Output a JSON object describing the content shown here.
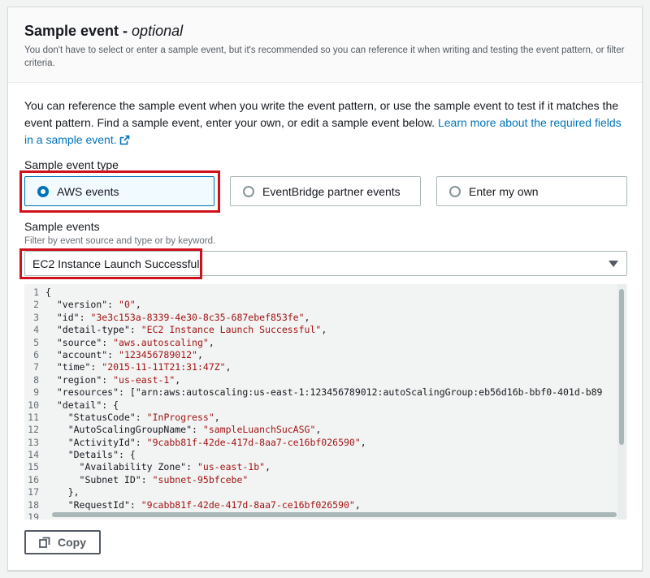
{
  "header": {
    "title": "Sample event - ",
    "title_optional": "optional",
    "description": "You don't have to select or enter a sample event, but it's recommended so you can reference it when writing and testing the event pattern, or filter criteria."
  },
  "intro": {
    "text": "You can reference the sample event when you write the event pattern, or use the sample event to test if it matches the event pattern. Find a sample event, enter your own, or edit a sample event below. ",
    "link": "Learn more about the required fields in a sample event."
  },
  "event_type": {
    "label": "Sample event type",
    "options": [
      {
        "label": "AWS events",
        "selected": true
      },
      {
        "label": "EventBridge partner events",
        "selected": false
      },
      {
        "label": "Enter my own",
        "selected": false
      }
    ]
  },
  "sample_events": {
    "label": "Sample events",
    "hint": "Filter by event source and type or by keyword.",
    "selected": "EC2 Instance Launch Successful"
  },
  "code_lines": [
    {
      "n": "1",
      "text": "{"
    },
    {
      "n": "2",
      "text": "  \"version\": \"0\","
    },
    {
      "n": "3",
      "text": "  \"id\": \"3e3c153a-8339-4e30-8c35-687ebef853fe\","
    },
    {
      "n": "4",
      "text": "  \"detail-type\": \"EC2 Instance Launch Successful\","
    },
    {
      "n": "5",
      "text": "  \"source\": \"aws.autoscaling\","
    },
    {
      "n": "6",
      "text": "  \"account\": \"123456789012\","
    },
    {
      "n": "7",
      "text": "  \"time\": \"2015-11-11T21:31:47Z\","
    },
    {
      "n": "8",
      "text": "  \"region\": \"us-east-1\","
    },
    {
      "n": "9",
      "text": "  \"resources\": [\"arn:aws:autoscaling:us-east-1:123456789012:autoScalingGroup:eb56d16b-bbf0-401d-b89"
    },
    {
      "n": "10",
      "text": "  \"detail\": {"
    },
    {
      "n": "11",
      "text": "    \"StatusCode\": \"InProgress\","
    },
    {
      "n": "12",
      "text": "    \"AutoScalingGroupName\": \"sampleLuanchSucASG\","
    },
    {
      "n": "13",
      "text": "    \"ActivityId\": \"9cabb81f-42de-417d-8aa7-ce16bf026590\","
    },
    {
      "n": "14",
      "text": "    \"Details\": {"
    },
    {
      "n": "15",
      "text": "      \"Availability Zone\": \"us-east-1b\","
    },
    {
      "n": "16",
      "text": "      \"Subnet ID\": \"subnet-95bfcebe\""
    },
    {
      "n": "17",
      "text": "    },"
    },
    {
      "n": "18",
      "text": "    \"RequestId\": \"9cabb81f-42de-417d-8aa7-ce16bf026590\","
    },
    {
      "n": "19",
      "text": ""
    }
  ],
  "copy_button": {
    "label": "Copy"
  },
  "colors": {
    "accent": "#0073bb",
    "highlight": "#d0101b"
  }
}
